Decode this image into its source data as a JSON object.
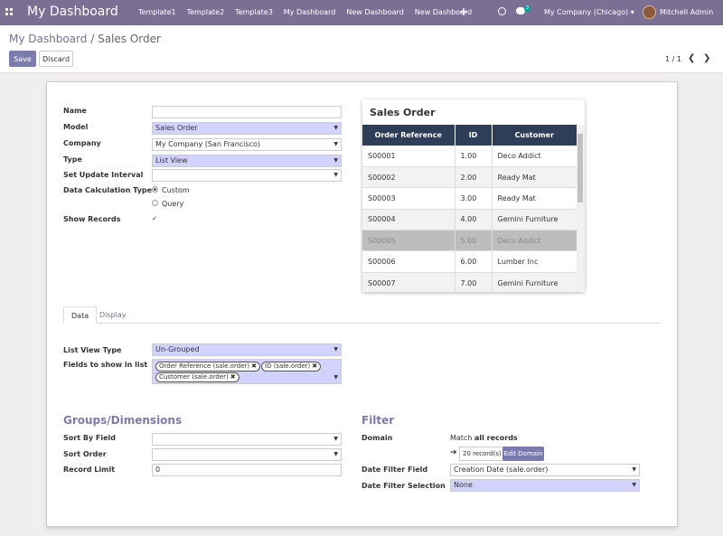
{
  "topbar": {
    "brand": "My Dashboard",
    "menu": [
      "Template1",
      "Template2",
      "Template3",
      "My Dashboard",
      "New Dashboard",
      "New Dashboard"
    ],
    "chat_count": "3",
    "company": "My Company (Chicago)",
    "user": "Mitchell Admin",
    "color": "#7c6f94"
  },
  "breadcrumb": {
    "parent": "My Dashboard",
    "sep": "/",
    "current": "Sales Order"
  },
  "buttons": {
    "save": "Save",
    "discard": "Discard"
  },
  "pager": {
    "text": "1 / 1"
  },
  "form": {
    "name_label": "Name",
    "name_value": "",
    "model_label": "Model",
    "model_value": "Sales Order",
    "company_label": "Company",
    "company_value": "My Company (San Francisco)",
    "type_label": "Type",
    "type_value": "List View",
    "interval_label": "Set Update Interval",
    "interval_value": "",
    "calc_label": "Data Calculation Type",
    "calc_custom": "Custom",
    "calc_query": "Query",
    "show_label": "Show Records"
  },
  "preview": {
    "title": "Sales Order",
    "columns": [
      "Order Reference",
      "ID",
      "Customer"
    ],
    "rows": [
      [
        "S00001",
        "1.00",
        "Deco Addict"
      ],
      [
        "S00002",
        "2.00",
        "Ready Mat"
      ],
      [
        "S00003",
        "3.00",
        "Ready Mat"
      ],
      [
        "S00004",
        "4.00",
        "Gemini Furniture"
      ],
      [
        "S00005",
        "5.00",
        "Deco Addict"
      ],
      [
        "S00006",
        "6.00",
        "Lumber Inc"
      ],
      [
        "S00007",
        "7.00",
        "Gemini Furniture"
      ]
    ]
  },
  "tabs": {
    "data": "Data",
    "display": "Display"
  },
  "list": {
    "type_label": "List View Type",
    "type_value": "Un-Grouped",
    "fields_label": "Fields to show in list",
    "fields": [
      "Order Reference (sale.order)",
      "ID (sale.order)",
      "Customer (sale.order)"
    ]
  },
  "groups": {
    "title": "Groups/Dimensions",
    "sort_by_label": "Sort By Field",
    "sort_order_label": "Sort Order",
    "limit_label": "Record Limit",
    "limit_value": "0"
  },
  "filter": {
    "title": "Filter",
    "domain_label": "Domain",
    "match_prefix": "Match",
    "match_bold": "all records",
    "records": "20 record(s)",
    "edit_domain": "Edit Domain",
    "date_field_label": "Date Filter Field",
    "date_field_value": "Creation Date (sale.order)",
    "date_sel_label": "Date Filter Selection",
    "date_sel_value": "None"
  }
}
